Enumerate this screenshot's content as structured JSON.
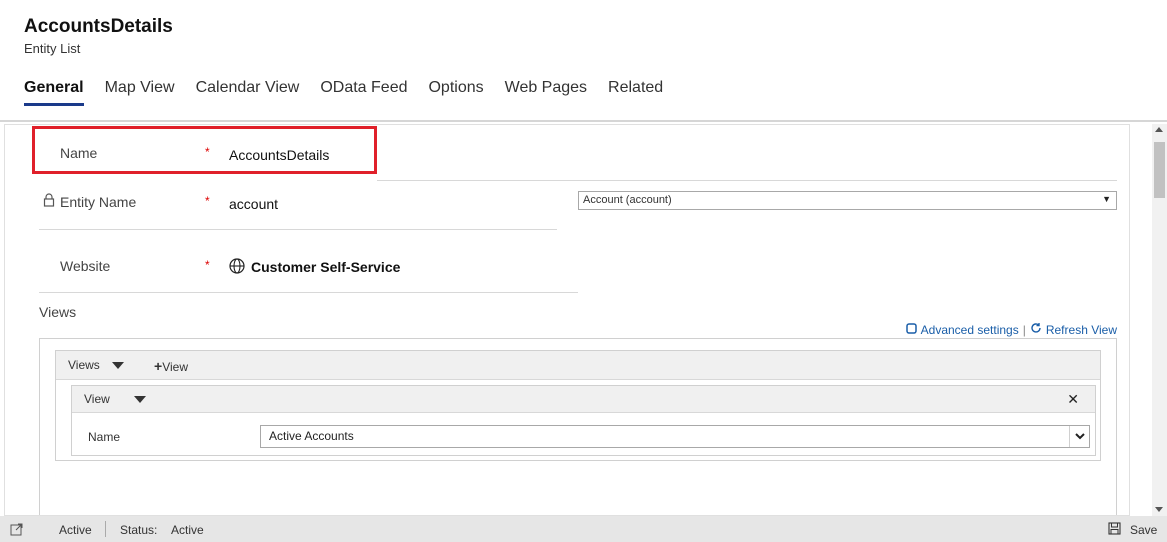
{
  "header": {
    "title": "AccountsDetails",
    "subtitle": "Entity List",
    "tabs": [
      {
        "label": "General",
        "active": true
      },
      {
        "label": "Map View"
      },
      {
        "label": "Calendar View"
      },
      {
        "label": "OData Feed"
      },
      {
        "label": "Options"
      },
      {
        "label": "Web Pages"
      },
      {
        "label": "Related"
      }
    ]
  },
  "form": {
    "name": {
      "label": "Name",
      "required": "*",
      "value": "AccountsDetails"
    },
    "entity_name": {
      "label": "Entity Name",
      "required": "*",
      "value": "account",
      "select_value": "Account (account)",
      "icon": "lock-icon"
    },
    "website": {
      "label": "Website",
      "required": "*",
      "value": "Customer Self-Service",
      "icon": "globe-icon"
    },
    "views_label": "Views",
    "advanced_settings": "Advanced settings",
    "refresh_view": "Refresh View",
    "views_toolbar": {
      "label": "Views",
      "add_view": "View"
    },
    "view_block": {
      "label": "View",
      "name_label": "Name",
      "name_value": "Active Accounts"
    }
  },
  "footer": {
    "state": "Active",
    "status_label": "Status:",
    "status_value": "Active",
    "save_label": "Save"
  },
  "colors": {
    "highlight": "#e0202a",
    "link": "#1a5ea8",
    "tab_underline": "#1a3a8a"
  }
}
